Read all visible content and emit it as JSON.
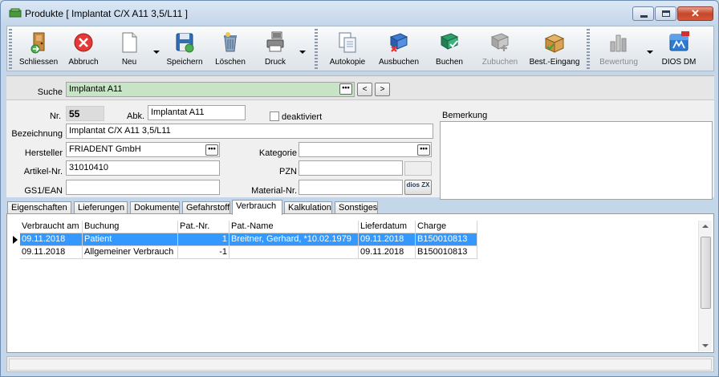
{
  "window": {
    "title": "Produkte [ Implantat C/X A11 3,5/L11 ]",
    "minimize_label": "",
    "maximize_label": "",
    "close_label": "✕"
  },
  "toolbar": {
    "schliessen": "Schliessen",
    "abbruch": "Abbruch",
    "neu": "Neu",
    "speichern": "Speichern",
    "loeschen": "Löschen",
    "druck": "Druck",
    "autokopie": "Autokopie",
    "ausbuchen": "Ausbuchen",
    "buchen": "Buchen",
    "zubuchen": "Zubuchen",
    "best_eingang": "Best.-Eingang",
    "bewertung": "Bewertung",
    "dios_dm": "DIOS DM"
  },
  "search": {
    "label": "Suche",
    "value": "Implantat A11",
    "prev": "<",
    "next": ">"
  },
  "form": {
    "nr_label": "Nr.",
    "nr_value": "55",
    "abk_label": "Abk.",
    "abk_value": "Implantat A11",
    "deaktiviert_label": "deaktiviert",
    "bemerkung_label": "Bemerkung",
    "bezeichnung_label": "Bezeichnung",
    "bezeichnung_value": "Implantat C/X A11 3,5/L11",
    "hersteller_label": "Hersteller",
    "hersteller_value": "FRIADENT GmbH",
    "kategorie_label": "Kategorie",
    "kategorie_value": "",
    "artikel_label": "Artikel-Nr.",
    "artikel_value": "31010410",
    "pzn_label": "PZN",
    "pzn_value": "",
    "gs1_label": "GS1/EAN",
    "gs1_value": "",
    "material_label": "Material-Nr.",
    "material_value": "",
    "dios_badge": "dios ZX"
  },
  "tabs": [
    {
      "label": "Eigenschaften"
    },
    {
      "label": "Lieferungen"
    },
    {
      "label": "Dokumente"
    },
    {
      "label": "Gefahrstoff"
    },
    {
      "label": "Verbrauch"
    },
    {
      "label": "Kalkulation"
    },
    {
      "label": "Sonstiges"
    }
  ],
  "active_tab": "Verbrauch",
  "table": {
    "columns": [
      "Verbraucht am",
      "Buchung",
      "Pat.-Nr.",
      "Pat.-Name",
      "Lieferdatum",
      "Charge"
    ],
    "rows": [
      {
        "date": "09.11.2018",
        "buchung": "Patient",
        "patnr": "1",
        "patname": "Breitner, Gerhard, *10.02.1979",
        "lieferdatum": "09.11.2018",
        "charge": "B150010813",
        "selected": true
      },
      {
        "date": "09.11.2018",
        "buchung": "Allgemeiner Verbrauch",
        "patnr": "-1",
        "patname": "",
        "lieferdatum": "09.11.2018",
        "charge": "B150010813",
        "selected": false
      }
    ]
  },
  "colors": {
    "selection": "#3399ff",
    "search_field": "#c8e4c6",
    "window_frame": "#c4d6ea"
  }
}
